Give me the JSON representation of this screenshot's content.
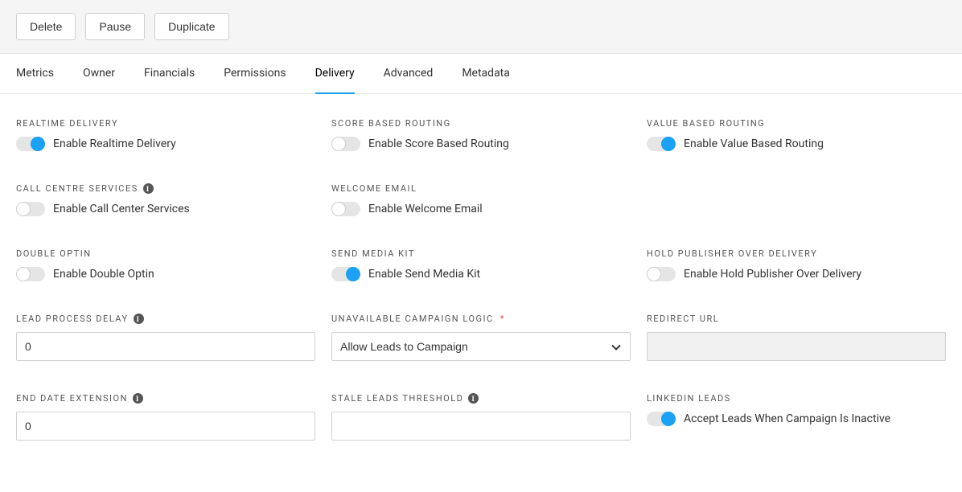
{
  "toolbar": {
    "delete": "Delete",
    "pause": "Pause",
    "duplicate": "Duplicate"
  },
  "tabs": {
    "metrics": "Metrics",
    "owner": "Owner",
    "financials": "Financials",
    "permissions": "Permissions",
    "delivery": "Delivery",
    "advanced": "Advanced",
    "metadata": "Metadata"
  },
  "sections": {
    "realtime_delivery": {
      "title": "REALTIME DELIVERY",
      "toggle_label": "Enable Realtime Delivery",
      "enabled": true
    },
    "score_based_routing": {
      "title": "SCORE BASED ROUTING",
      "toggle_label": "Enable Score Based Routing",
      "enabled": false
    },
    "value_based_routing": {
      "title": "VALUE BASED ROUTING",
      "toggle_label": "Enable Value Based Routing",
      "enabled": true
    },
    "call_centre_services": {
      "title": "CALL CENTRE SERVICES",
      "toggle_label": "Enable Call Center Services",
      "enabled": false
    },
    "welcome_email": {
      "title": "WELCOME EMAIL",
      "toggle_label": "Enable Welcome Email",
      "enabled": false
    },
    "double_optin": {
      "title": "DOUBLE OPTIN",
      "toggle_label": "Enable Double Optin",
      "enabled": false
    },
    "send_media_kit": {
      "title": "SEND MEDIA KIT",
      "toggle_label": "Enable Send Media Kit",
      "enabled": true
    },
    "hold_publisher_over_delivery": {
      "title": "HOLD PUBLISHER OVER DELIVERY",
      "toggle_label": "Enable Hold Publisher Over Delivery",
      "enabled": false
    },
    "lead_process_delay": {
      "title": "LEAD PROCESS DELAY",
      "value": "0"
    },
    "unavailable_campaign_logic": {
      "title": "UNAVAILABLE CAMPAIGN LOGIC",
      "value": "Allow Leads to Campaign"
    },
    "redirect_url": {
      "title": "REDIRECT URL",
      "value": ""
    },
    "end_date_extension": {
      "title": "END DATE EXTENSION",
      "value": "0"
    },
    "stale_leads_threshold": {
      "title": "STALE LEADS THRESHOLD",
      "value": ""
    },
    "linkedin_leads": {
      "title": "LINKEDIN LEADS",
      "toggle_label": "Accept Leads When Campaign Is Inactive",
      "enabled": true
    }
  }
}
